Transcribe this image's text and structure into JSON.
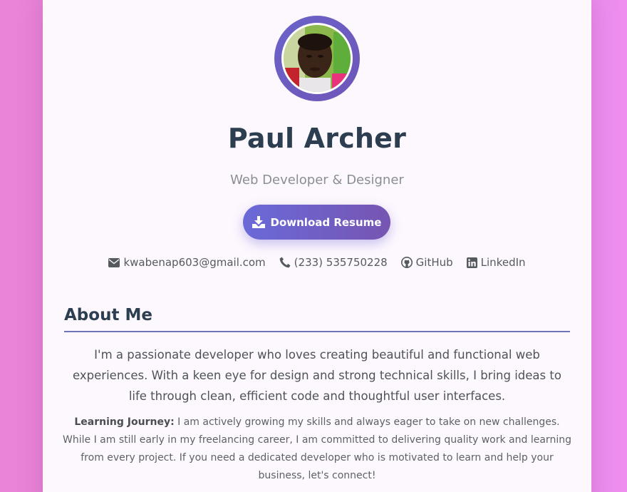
{
  "profile": {
    "name": "Paul Archer",
    "title": "Web Developer & Designer",
    "avatar_alt": "profile-photo"
  },
  "actions": {
    "download_label": "Download Resume",
    "download_icon": "download-icon"
  },
  "contacts": {
    "email": "kwabenap603@gmail.com",
    "phone": "(233) 535750228",
    "github": "GitHub",
    "linkedin": "LinkedIn"
  },
  "about": {
    "heading": "About Me",
    "paragraph": "I'm a passionate developer who loves creating beautiful and functional web experiences. With a keen eye for design and strong technical skills, I bring ideas to life through clean, efficient code and thoughtful user interfaces.",
    "journey_label": "Learning Journey:",
    "journey_text": " I am actively growing my skills and always eager to take on new challenges. While I am still early in my freelancing career, I am committed to delivering quality work and learning from every project. If you need a dedicated developer who is motivated to learn and help your business, let's connect!"
  },
  "colors": {
    "background": "#ee8ee4",
    "card": "#fdf8fe",
    "accent": "#6a63c9",
    "heading": "#2c3e50"
  }
}
